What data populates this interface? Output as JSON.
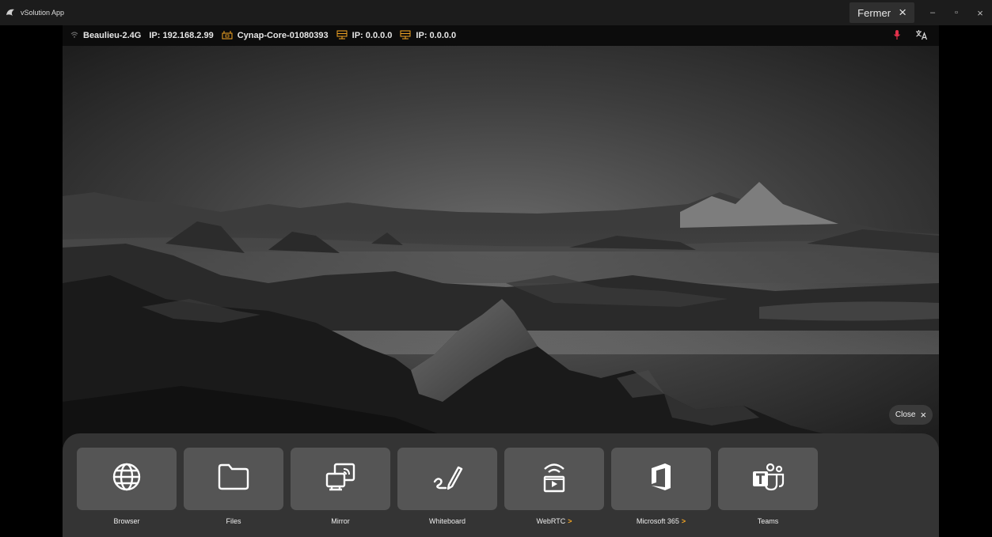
{
  "window": {
    "app_title": "vSolution App",
    "close_label": "Fermer",
    "close_icon": "×",
    "minimize_icon": "–",
    "restore_icon": "▫",
    "window_close_icon": "×"
  },
  "statusbar": {
    "wifi_ssid": "Beaulieu-2.4G",
    "wifi_ip": "IP: 192.168.2.99",
    "device_name": "Cynap-Core-01080393",
    "lan1_ip": "IP: 0.0.0.0",
    "lan2_ip": "IP: 0.0.0.0",
    "mic_icon": "microphone-icon",
    "translate_icon": "translate-icon",
    "mic_color": "#e0314b"
  },
  "overlay": {
    "close_label": "Close"
  },
  "dock": {
    "items": [
      {
        "label": "Browser",
        "icon": "globe-icon",
        "has_submenu": false
      },
      {
        "label": "Files",
        "icon": "folder-icon",
        "has_submenu": false
      },
      {
        "label": "Mirror",
        "icon": "mirror-icon",
        "has_submenu": false
      },
      {
        "label": "Whiteboard",
        "icon": "pen-icon",
        "has_submenu": false
      },
      {
        "label": "WebRTC",
        "icon": "webrtc-icon",
        "has_submenu": true
      },
      {
        "label": "Microsoft 365",
        "icon": "office-icon",
        "has_submenu": true
      },
      {
        "label": "Teams",
        "icon": "teams-icon",
        "has_submenu": false
      }
    ],
    "submenu_chevron": ">",
    "accent_color": "#f5a623"
  }
}
